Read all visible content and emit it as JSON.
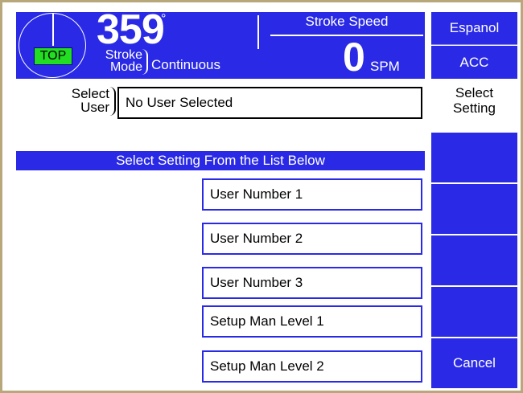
{
  "header": {
    "angle_value": "359",
    "angle_unit": "°",
    "top_badge": "TOP",
    "stroke_mode_label_line1": "Stroke",
    "stroke_mode_label_line2": "Mode",
    "stroke_mode_value": "Continuous",
    "speed_label": "Stroke Speed",
    "speed_value": "0",
    "speed_unit": "SPM"
  },
  "side": {
    "espanol": "Espanol",
    "acc": "ACC",
    "select_setting_line1": "Select",
    "select_setting_line2": "Setting",
    "cancel": "Cancel"
  },
  "select_user": {
    "label_line1": "Select",
    "label_line2": "User",
    "value": "No User Selected"
  },
  "list": {
    "header": "Select Setting From the List Below",
    "items": [
      "User Number 1",
      "User Number 2",
      "User Number 3",
      "Setup Man Level 1",
      "Setup Man Level 2"
    ]
  },
  "colors": {
    "accent_blue": "#2a2ae6",
    "top_green": "#22dd22",
    "frame": "#b7a77a"
  }
}
